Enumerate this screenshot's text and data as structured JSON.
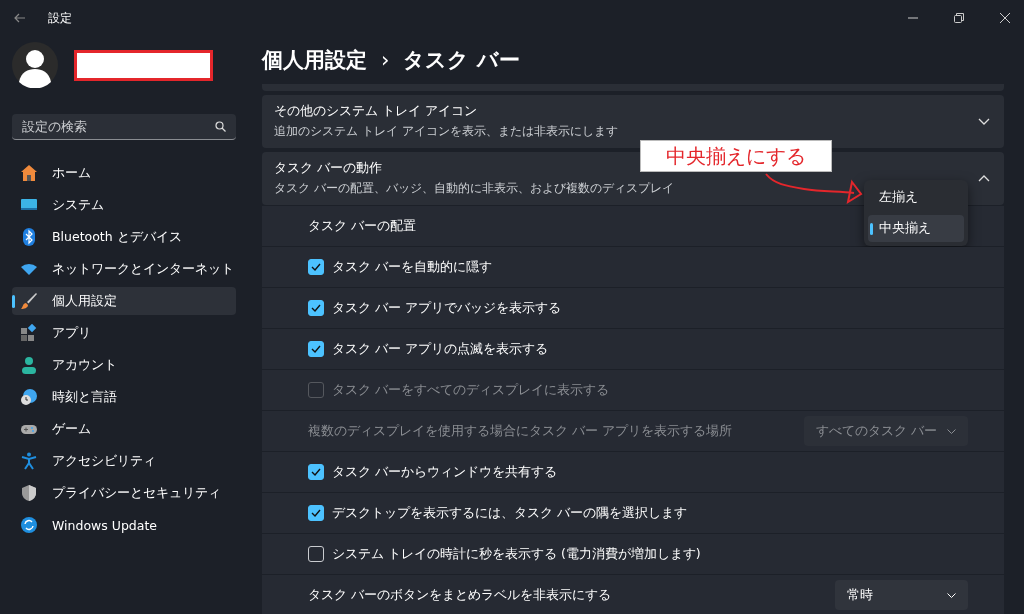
{
  "window": {
    "title": "設定"
  },
  "sidebar": {
    "search": {
      "placeholder": "設定の検索"
    },
    "items": [
      {
        "label": "ホーム",
        "selected": false
      },
      {
        "label": "システム",
        "selected": false
      },
      {
        "label": "Bluetooth とデバイス",
        "selected": false
      },
      {
        "label": "ネットワークとインターネット",
        "selected": false
      },
      {
        "label": "個人用設定",
        "selected": true
      },
      {
        "label": "アプリ",
        "selected": false
      },
      {
        "label": "アカウント",
        "selected": false
      },
      {
        "label": "時刻と言語",
        "selected": false
      },
      {
        "label": "ゲーム",
        "selected": false
      },
      {
        "label": "アクセシビリティ",
        "selected": false
      },
      {
        "label": "プライバシーとセキュリティ",
        "selected": false
      },
      {
        "label": "Windows Update",
        "selected": false
      }
    ]
  },
  "breadcrumb": {
    "parent": "個人用設定",
    "separator": "›",
    "current": "タスク バー"
  },
  "cards": [
    {
      "title": "その他のシステム トレイ アイコン",
      "subtitle": "追加のシステム トレイ アイコンを表示、または非表示にします",
      "expanded": false
    },
    {
      "title": "タスク バーの動作",
      "subtitle": "タスク バーの配置、バッジ、自動的に非表示、および複数のディスプレイ",
      "expanded": true
    }
  ],
  "rows": [
    {
      "kind": "flyout",
      "label": "タスク バーの配置",
      "options": [
        {
          "label": "左揃え",
          "selected": false
        },
        {
          "label": "中央揃え",
          "selected": true
        }
      ]
    },
    {
      "kind": "checkbox",
      "label": "タスク バーを自動的に隠す",
      "checked": true,
      "disabled": false
    },
    {
      "kind": "checkbox",
      "label": "タスク バー アプリでバッジを表示する",
      "checked": true,
      "disabled": false
    },
    {
      "kind": "checkbox",
      "label": "タスク バー アプリの点滅を表示する",
      "checked": true,
      "disabled": false
    },
    {
      "kind": "checkbox",
      "label": "タスク バーをすべてのディスプレイに表示する",
      "checked": false,
      "disabled": true
    },
    {
      "kind": "dropdown",
      "label": "複数のディスプレイを使用する場合にタスク バー アプリを表示する場所",
      "value": "すべてのタスク バー",
      "disabled": true
    },
    {
      "kind": "checkbox",
      "label": "タスク バーからウィンドウを共有する",
      "checked": true,
      "disabled": false
    },
    {
      "kind": "checkbox",
      "label": "デスクトップを表示するには、タスク バーの隅を選択します",
      "checked": true,
      "disabled": false
    },
    {
      "kind": "checkbox",
      "label": "システム トレイの時計に秒を表示する (電力消費が増加します)",
      "checked": false,
      "disabled": false
    },
    {
      "kind": "dropdown",
      "label": "タスク バーのボタンをまとめラベルを非表示にする",
      "value": "常時",
      "disabled": false
    }
  ],
  "annotation": {
    "text": "中央揃えにする"
  }
}
